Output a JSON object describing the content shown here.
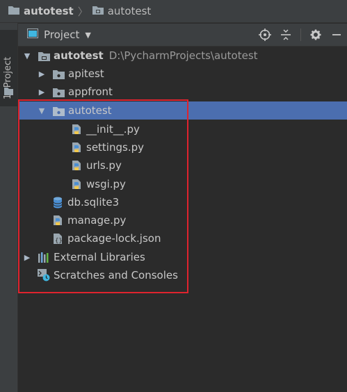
{
  "breadcrumb": {
    "items": [
      {
        "label": "autotest",
        "icon": "folder-icon"
      },
      {
        "label": "autotest",
        "icon": "folder-icon"
      }
    ]
  },
  "side_tab": {
    "label": "1: Project",
    "icon": "folder-icon"
  },
  "toolbar": {
    "title": "Project",
    "dropdown_icon": "caret-down-icon",
    "actions": [
      "locate-icon",
      "collapse-all-icon",
      "gear-icon",
      "hide-icon"
    ]
  },
  "tree": {
    "root": {
      "label": "autotest",
      "path": "D:\\PycharmProjects\\autotest"
    },
    "items": [
      {
        "label": "apitest",
        "icon": "folder-icon",
        "expanded": false
      },
      {
        "label": "appfront",
        "icon": "folder-icon",
        "expanded": false
      },
      {
        "label": "autotest",
        "icon": "folder-icon",
        "expanded": true,
        "selected": true
      },
      {
        "label": "__init__.py",
        "icon": "python-file-icon"
      },
      {
        "label": "settings.py",
        "icon": "python-file-icon"
      },
      {
        "label": "urls.py",
        "icon": "python-file-icon"
      },
      {
        "label": "wsgi.py",
        "icon": "python-file-icon"
      },
      {
        "label": "db.sqlite3",
        "icon": "database-icon"
      },
      {
        "label": "manage.py",
        "icon": "python-file-icon"
      },
      {
        "label": "package-lock.json",
        "icon": "json-file-icon"
      },
      {
        "label": "External Libraries",
        "icon": "library-icon",
        "expanded": false
      },
      {
        "label": "Scratches and Consoles",
        "icon": "scratches-icon"
      }
    ]
  },
  "colors": {
    "background": "#2b2b2b",
    "panel": "#3c3f41",
    "selection": "#4b6eaf",
    "highlight_border": "#e0232e"
  }
}
